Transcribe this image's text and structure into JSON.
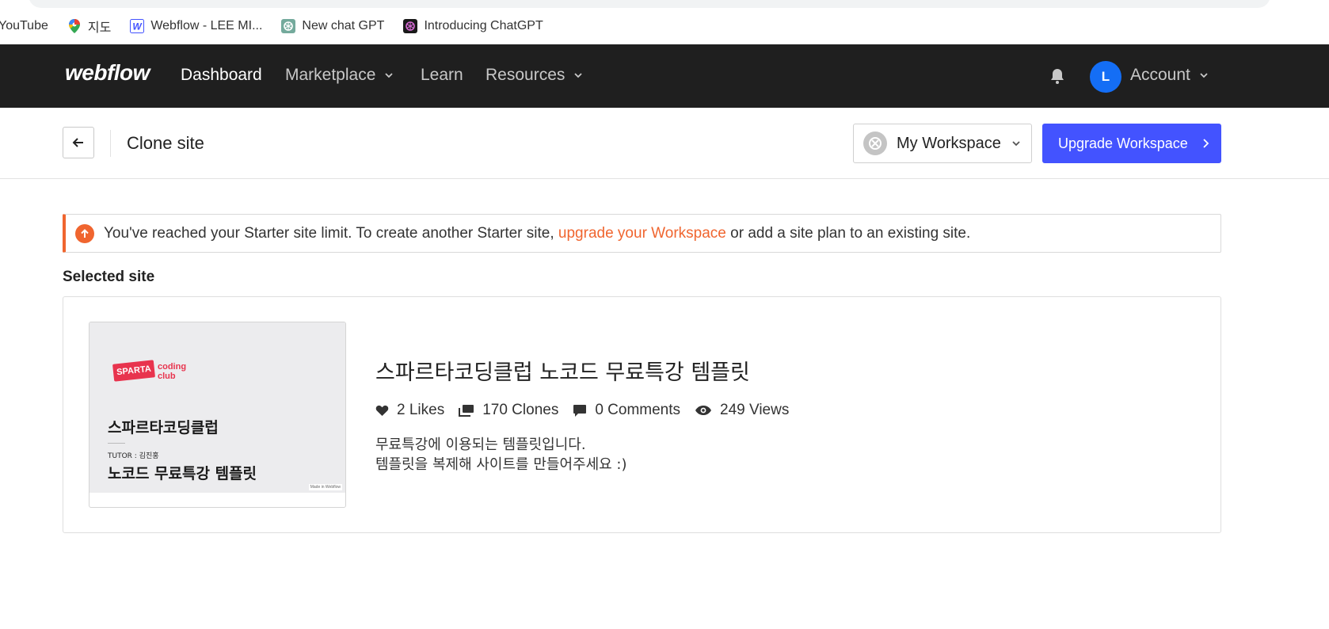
{
  "bookmarks": [
    {
      "label": "YouTube",
      "icon": "youtube-icon"
    },
    {
      "label": "지도",
      "icon": "maps-pin-icon"
    },
    {
      "label": "Webflow - LEE MI...",
      "icon": "webflow-w-icon"
    },
    {
      "label": "New chat GPT",
      "icon": "openai-icon"
    },
    {
      "label": "Introducing ChatGPT",
      "icon": "openai-dark-icon"
    }
  ],
  "nav": {
    "logo": "webflow",
    "items": [
      "Dashboard",
      "Marketplace",
      "Learn",
      "Resources"
    ],
    "active": "Dashboard",
    "avatar_initial": "L",
    "account_label": "Account"
  },
  "subheader": {
    "title": "Clone site",
    "workspace_label": "My Workspace",
    "upgrade_label": "Upgrade Workspace"
  },
  "alert": {
    "text_before": "You've reached your Starter site limit. To create another Starter site,",
    "link_text": "upgrade your Workspace",
    "text_after": "or add a site plan to an existing site."
  },
  "selected_site": {
    "section_label": "Selected site",
    "title": "스파르타코딩클럽 노코드 무료특강 템플릿",
    "likes": "2 Likes",
    "clones": "170 Clones",
    "comments": "0 Comments",
    "views": "249 Views",
    "description_line1": "무료특강에 이용되는 템플릿입니다.",
    "description_line2": "템플릿을 복제해 사이트를 만들어주세요 :)",
    "thumbnail": {
      "badge": "SPARTA",
      "brand_line1": "coding",
      "brand_line2": "club",
      "title_line1": "스파르타코딩클럽",
      "title_line2": "노코드 무료특강 템플릿",
      "tutor": "TUTOR : 김진홍",
      "made_in": "Made in Webflow"
    }
  },
  "colors": {
    "nav_bg": "#1f1f1f",
    "accent_blue": "#4353ff",
    "avatar_blue": "#146ef5",
    "alert_orange": "#f0652f",
    "sparta_red": "#e8344e"
  }
}
